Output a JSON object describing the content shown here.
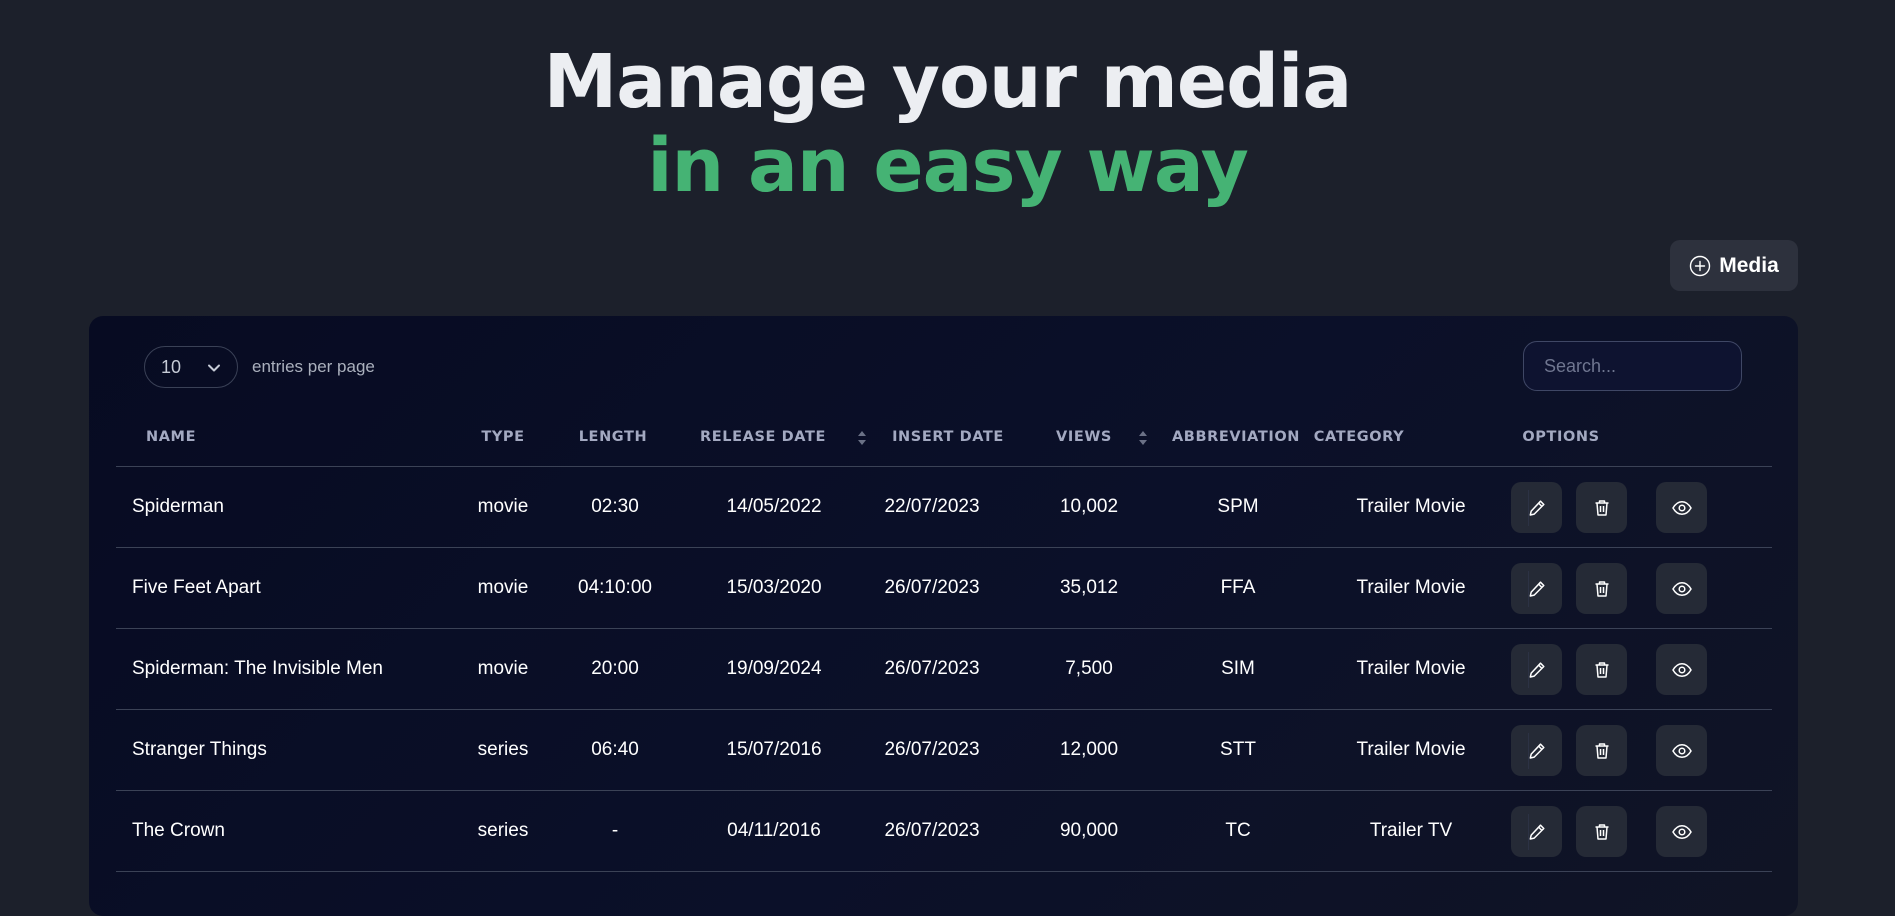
{
  "hero": {
    "line1": "Manage your media",
    "line2": "in an easy way"
  },
  "add_button": {
    "label": "Media",
    "icon": "plus-circle-icon"
  },
  "table_controls": {
    "entries_value": "10",
    "entries_label": "entries per page",
    "search_placeholder": "Search..."
  },
  "columns": [
    {
      "key": "name",
      "label": "NAME",
      "sortable": false
    },
    {
      "key": "type",
      "label": "TYPE",
      "sortable": false
    },
    {
      "key": "length",
      "label": "LENGTH",
      "sortable": false
    },
    {
      "key": "release_date",
      "label": "RELEASE DATE",
      "sortable": true
    },
    {
      "key": "insert_date",
      "label": "INSERT DATE",
      "sortable": false
    },
    {
      "key": "views",
      "label": "VIEWS",
      "sortable": true
    },
    {
      "key": "abbreviation",
      "label": "ABBREVIATION",
      "sortable": false
    },
    {
      "key": "category",
      "label": "CATEGORY",
      "sortable": false
    },
    {
      "key": "options",
      "label": "OPTIONS",
      "sortable": false
    }
  ],
  "rows": [
    {
      "name": "Spiderman",
      "type": "movie",
      "length": "02:30",
      "release_date": "14/05/2022",
      "insert_date": "22/07/2023",
      "views": "10,002",
      "abbreviation": "SPM",
      "category": "Trailer Movie"
    },
    {
      "name": "Five Feet Apart",
      "type": "movie",
      "length": "04:10:00",
      "release_date": "15/03/2020",
      "insert_date": "26/07/2023",
      "views": "35,012",
      "abbreviation": "FFA",
      "category": "Trailer Movie"
    },
    {
      "name": "Spiderman: The Invisible Men",
      "type": "movie",
      "length": "20:00",
      "release_date": "19/09/2024",
      "insert_date": "26/07/2023",
      "views": "7,500",
      "abbreviation": "SIM",
      "category": "Trailer Movie"
    },
    {
      "name": "Stranger Things",
      "type": "series",
      "length": "06:40",
      "release_date": "15/07/2016",
      "insert_date": "26/07/2023",
      "views": "12,000",
      "abbreviation": "STT",
      "category": "Trailer Movie"
    },
    {
      "name": "The Crown",
      "type": "series",
      "length": "-",
      "release_date": "04/11/2016",
      "insert_date": "26/07/2023",
      "views": "90,000",
      "abbreviation": "TC",
      "category": "Trailer TV"
    }
  ],
  "row_actions": [
    {
      "key": "edit",
      "icon": "pencil-icon"
    },
    {
      "key": "delete",
      "icon": "trash-icon"
    },
    {
      "key": "view",
      "icon": "eye-icon"
    }
  ],
  "colors": {
    "background": "#1c202b",
    "accent_green": "#45b374",
    "panel": "#0b1029",
    "button": "#2d313d"
  }
}
